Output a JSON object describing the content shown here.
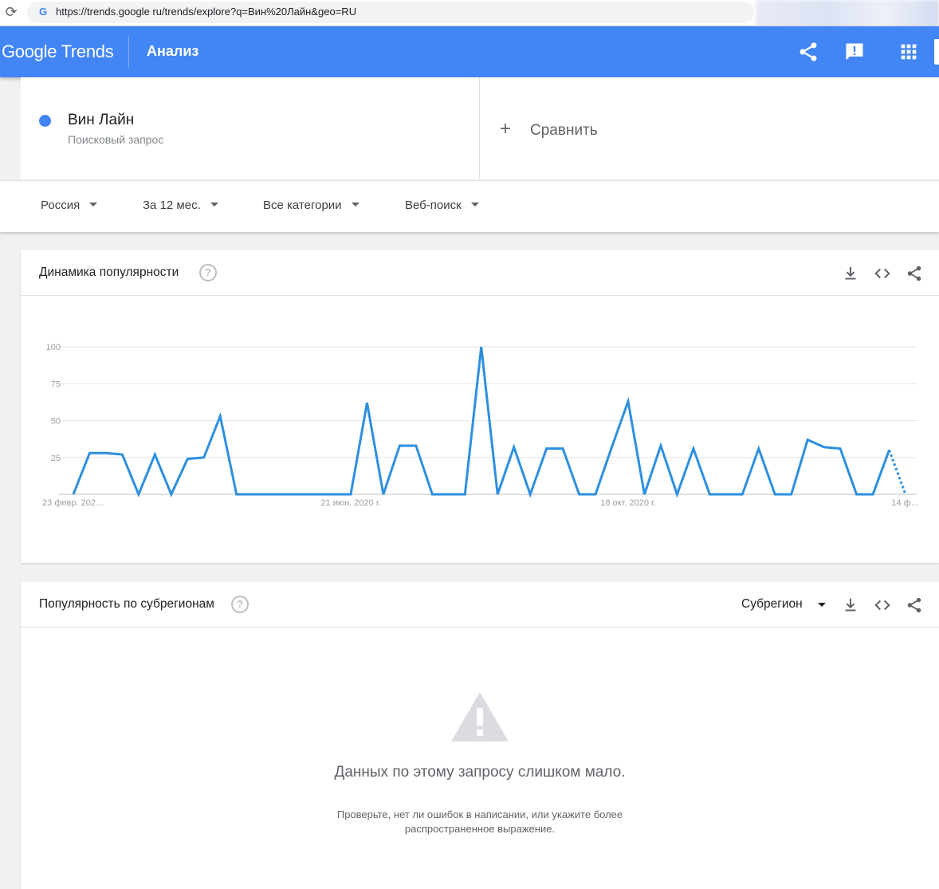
{
  "browser": {
    "url": "https://trends.google ru/trends/explore?q=Вин%20Лайн&geo=RU"
  },
  "header": {
    "brand_google": "Google",
    "brand_trends": "Trends",
    "title": "Анализ"
  },
  "term": {
    "name": "Вин Лайн",
    "type": "Поисковый запрос",
    "color": "#4285f4"
  },
  "compare": {
    "label": "Сравнить"
  },
  "filters": {
    "region": "Россия",
    "period": "За 12 мес.",
    "category": "Все категории",
    "search_type": "Веб-поиск"
  },
  "interest_card": {
    "title": "Динамика популярности"
  },
  "chart_data": {
    "type": "line",
    "series": [
      {
        "values": [
          0,
          28,
          28,
          27,
          0,
          27,
          0,
          24,
          25,
          53,
          0,
          0,
          0,
          0,
          0,
          0,
          0,
          0,
          62,
          0,
          33,
          33,
          0,
          0,
          0,
          100,
          0,
          32,
          0,
          31,
          31,
          0,
          0,
          32,
          63,
          0,
          33,
          0,
          31,
          0,
          0,
          0,
          31,
          0,
          0,
          37,
          32,
          31,
          0,
          0,
          30,
          0
        ],
        "partial_last": true,
        "color": "#2d8fe0"
      }
    ],
    "x_tick_labels": [
      "23 февр. 202…",
      "21 июн. 2020 г.",
      "18 окт. 2020 г.",
      "14 ф…"
    ],
    "y_ticks": [
      25,
      50,
      75,
      100
    ],
    "ylim": [
      0,
      100
    ],
    "grid": true
  },
  "subregion_card": {
    "title": "Популярность по субрегионам",
    "selector": "Субрегион",
    "no_data_title": "Данных по этому запросу слишком мало.",
    "no_data_hint": "Проверьте, нет ли ошибок в написании, или укажите более распространенное выражение."
  }
}
